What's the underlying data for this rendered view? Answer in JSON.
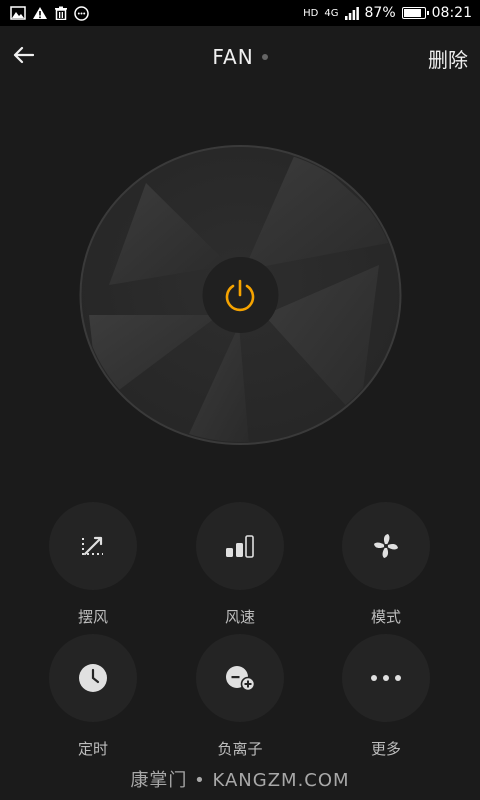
{
  "status_bar": {
    "network_badge": "HD",
    "network_type": "4G",
    "battery_text": "87%",
    "battery_level": 0.87,
    "time": "08:21"
  },
  "header": {
    "title": "FAN",
    "delete_label": "删除"
  },
  "fan": {
    "power_icon": "power-icon",
    "accent_color": "#f5a300"
  },
  "controls": [
    {
      "label": "摆风",
      "icon": "oscillate-icon"
    },
    {
      "label": "风速",
      "icon": "speed-bars-icon"
    },
    {
      "label": "模式",
      "icon": "fan-mode-icon"
    },
    {
      "label": "定时",
      "icon": "clock-icon"
    },
    {
      "label": "负离子",
      "icon": "ion-icon"
    },
    {
      "label": "更多",
      "icon": "more-dots-icon"
    }
  ],
  "watermark": "康掌门 • KANGZM.COM"
}
